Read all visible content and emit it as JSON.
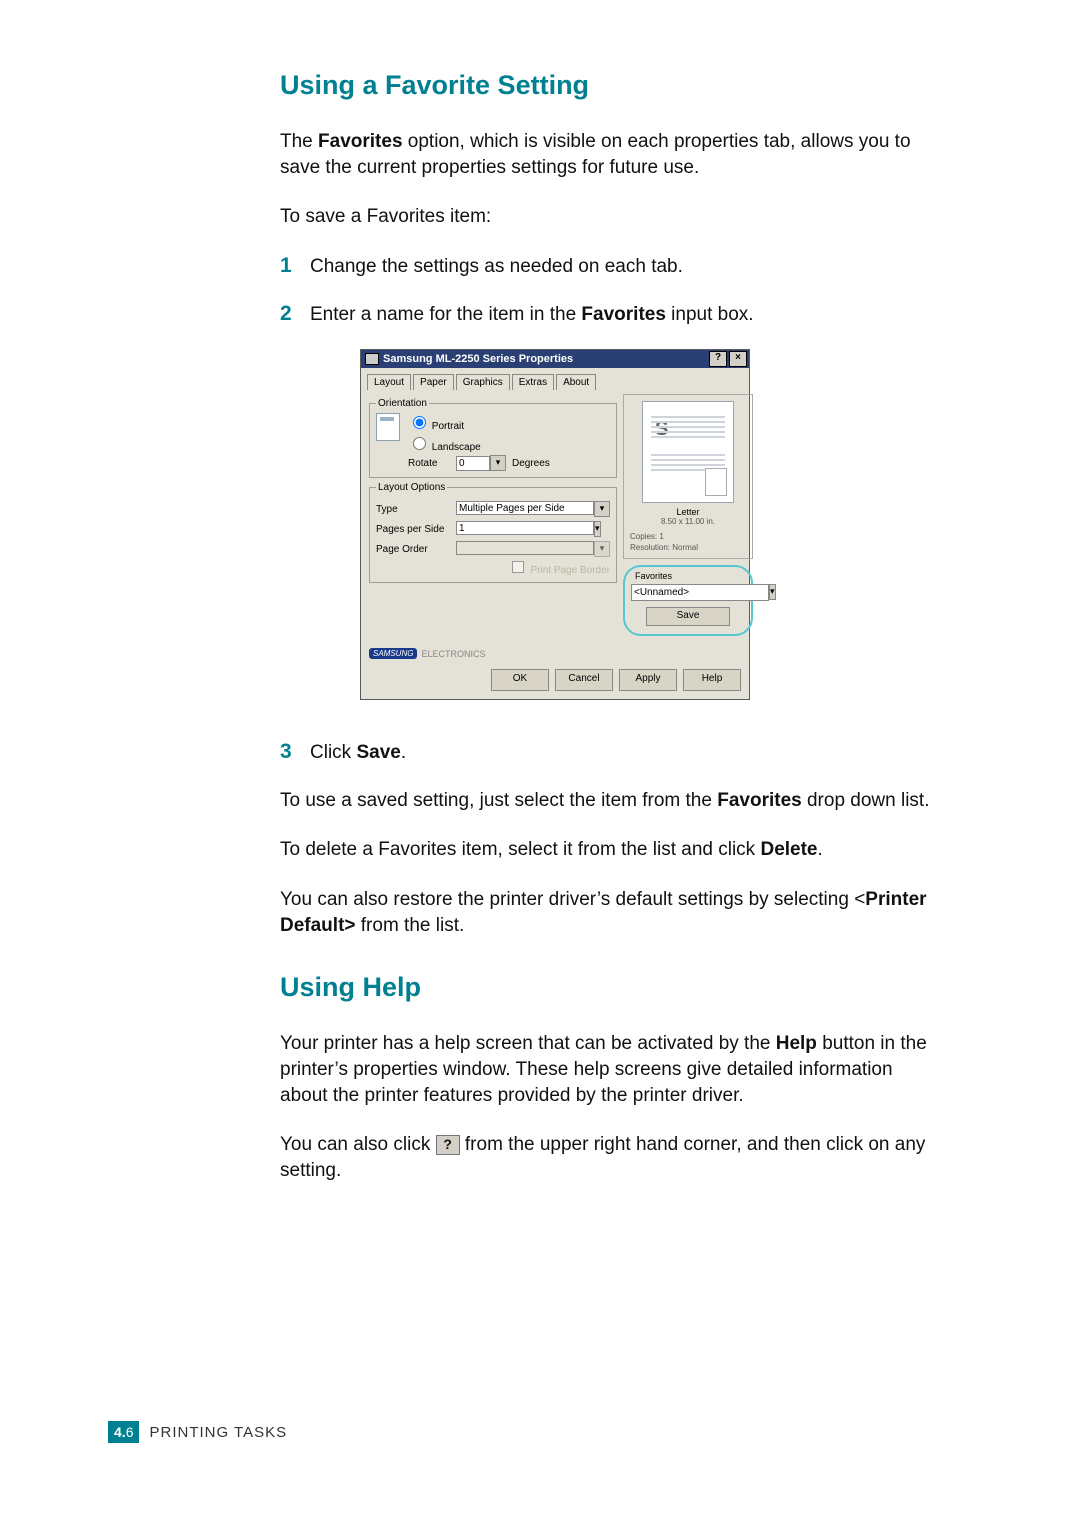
{
  "heading1": "Using a Favorite Setting",
  "para_intro": {
    "pre": "The ",
    "bold": "Favorites",
    "post": " option, which is visible on each properties tab, allows you to save the current properties settings for future use."
  },
  "para_save_intro": "To save a Favorites item:",
  "steps12": {
    "s1": {
      "num": "1",
      "text": "Change the settings as needed on each tab."
    },
    "s2": {
      "num": "2",
      "pre": "Enter a name for the item in the ",
      "bold": "Favorites",
      "post": " input box."
    }
  },
  "dialog": {
    "title": "Samsung ML-2250 Series Properties",
    "help_btn": "?",
    "close_btn": "×",
    "tabs": [
      "Layout",
      "Paper",
      "Graphics",
      "Extras",
      "About"
    ],
    "orientation": {
      "legend": "Orientation",
      "portrait": "Portrait",
      "landscape": "Landscape",
      "rotate_lbl": "Rotate",
      "rotate_val": "0",
      "degrees": "Degrees"
    },
    "layout_options": {
      "legend": "Layout Options",
      "type_lbl": "Type",
      "type_val": "Multiple Pages per Side",
      "pps_lbl": "Pages per Side",
      "pps_val": "1",
      "po_lbl": "Page Order",
      "po_val": "",
      "ppb": "Print Page Border"
    },
    "preview": {
      "s_mark": "S",
      "paper_name": "Letter",
      "paper_dims": "8.50 x 11.00 in.",
      "copies": "Copies: 1",
      "resolution": "Resolution: Normal"
    },
    "favorites": {
      "legend": "Favorites",
      "value": "<Unnamed>",
      "save": "Save"
    },
    "logo": {
      "brand": "SAMSUNG",
      "sub": "ELECTRONICS"
    },
    "buttons": {
      "ok": "OK",
      "cancel": "Cancel",
      "apply": "Apply",
      "help": "Help"
    }
  },
  "step3": {
    "num": "3",
    "pre": "Click ",
    "bold": "Save",
    "post": "."
  },
  "para_use": {
    "pre": "To use a saved setting, just select the item from the ",
    "bold": "Favorites",
    "post": " drop down list."
  },
  "para_delete": {
    "pre": "To delete a Favorites item, select it from the list and click ",
    "bold": "Delete",
    "post": "."
  },
  "para_restore": {
    "pre": "You can also restore the printer driver’s default settings by selecting <",
    "bold": "Printer Default>",
    "post": " from the list."
  },
  "heading2": "Using Help",
  "para_help1": {
    "pre": "Your printer has a help screen that can be activated by the ",
    "bold": "Help",
    "post": " button in the printer’s properties window. These help screens give detailed information about the printer features provided by the printer driver."
  },
  "para_help2": {
    "pre": "You can also click ",
    "icon": "?",
    "post": " from the upper right hand corner, and then click on any setting."
  },
  "footer": {
    "chapter": "4.",
    "page": "6",
    "title": "PRINTING TASKS"
  }
}
